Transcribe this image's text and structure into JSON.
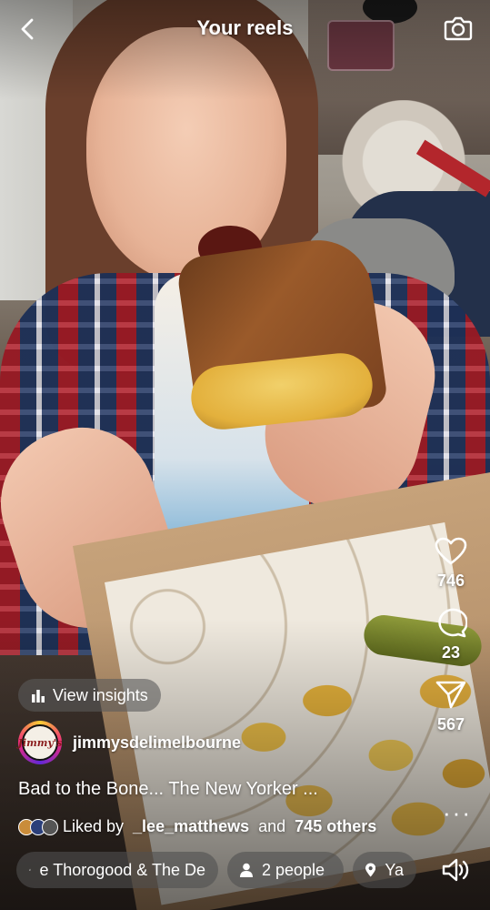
{
  "header": {
    "title": "Your reels",
    "back_icon": "chevron-left-icon",
    "camera_icon": "camera-icon"
  },
  "actions": {
    "likes": "746",
    "comments": "23",
    "shares": "567",
    "more_icon": "more-horizontal-icon"
  },
  "insights": {
    "label": "View insights",
    "icon": "bar-chart-icon"
  },
  "account": {
    "username": "jimmysdelimelbourne",
    "avatar_text": "Jimmy's"
  },
  "caption": "Bad to the Bone... The New Yorker ...",
  "liked_by": {
    "prefix": "Liked by",
    "user": "_lee_matthews",
    "conj": "and",
    "others": "745 others"
  },
  "bottom": {
    "music": "e Thorogood & The De",
    "people": "2 people",
    "location": "Ya",
    "music_icon": "music-note-icon",
    "people_icon": "person-icon",
    "location_icon": "location-pin-icon",
    "sound_icon": "speaker-icon"
  },
  "colors": {
    "avatar_ring": [
      "#f9ce34",
      "#ee2a7b",
      "#6228d7"
    ],
    "pill_bg": "rgba(80,80,80,0.6)"
  }
}
